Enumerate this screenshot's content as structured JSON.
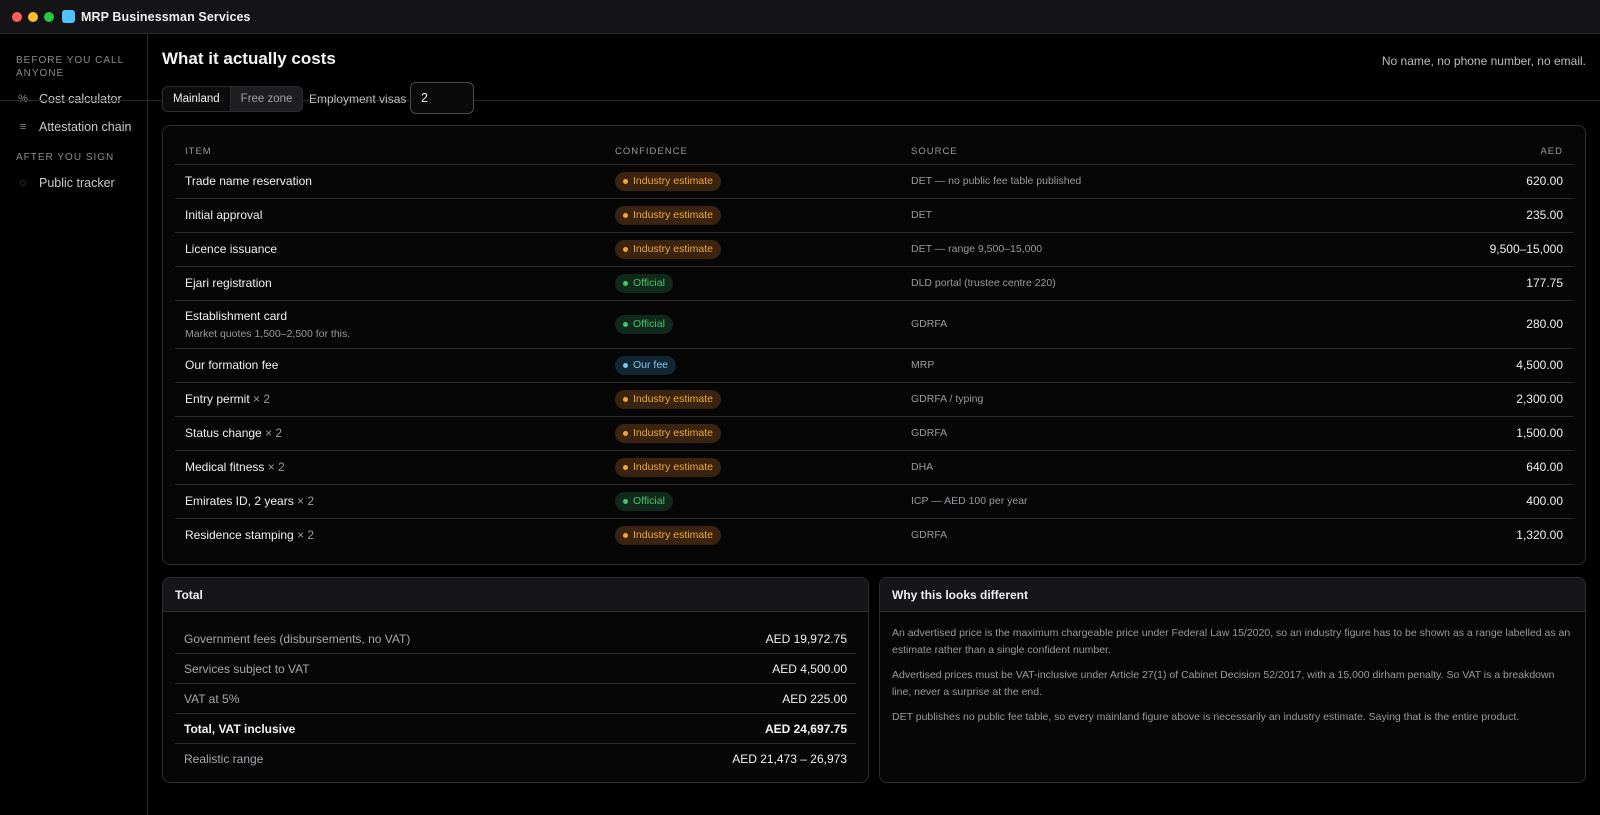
{
  "window": {
    "title": "MRP Businessman Services"
  },
  "sidebar": {
    "sections": [
      {
        "label": "BEFORE YOU CALL ANYONE"
      },
      {
        "label": "AFTER YOU SIGN"
      }
    ],
    "items": [
      {
        "icon": "%",
        "label": "Cost calculator"
      },
      {
        "icon": "≡",
        "label": "Attestation chain"
      },
      {
        "icon": "◌",
        "label": "Public tracker"
      }
    ]
  },
  "header": {
    "title": "What it actually costs",
    "privacy_note": "No name, no phone number, no email."
  },
  "controls": {
    "zones": [
      "Mainland",
      "Free zone"
    ],
    "selected_zone": "Mainland",
    "visas_label": "Employment visas",
    "visas_value": "2"
  },
  "table": {
    "headers": {
      "item": "ITEM",
      "confidence": "CONFIDENCE",
      "source": "SOURCE",
      "amount": "AED"
    },
    "rows": [
      {
        "item": "Trade name reservation",
        "mult": "",
        "note": "",
        "confidence": "Industry estimate",
        "kind": "est",
        "source": "DET — no public fee table published",
        "amount": "620.00"
      },
      {
        "item": "Initial approval",
        "mult": "",
        "note": "",
        "confidence": "Industry estimate",
        "kind": "est",
        "source": "DET",
        "amount": "235.00"
      },
      {
        "item": "Licence issuance",
        "mult": "",
        "note": "",
        "confidence": "Industry estimate",
        "kind": "est",
        "source": "DET — range 9,500–15,000",
        "amount": "9,500–15,000"
      },
      {
        "item": "Ejari registration",
        "mult": "",
        "note": "",
        "confidence": "Official",
        "kind": "off",
        "source": "DLD portal (trustee centre 220)",
        "amount": "177.75"
      },
      {
        "item": "Establishment card",
        "mult": "",
        "note": "Market quotes 1,500–2,500 for this.",
        "confidence": "Official",
        "kind": "off",
        "source": "GDRFA",
        "amount": "280.00"
      },
      {
        "item": "Our formation fee",
        "mult": "",
        "note": "",
        "confidence": "Our fee",
        "kind": "fee",
        "source": "MRP",
        "amount": "4,500.00"
      },
      {
        "item": "Entry permit",
        "mult": "× 2",
        "note": "",
        "confidence": "Industry estimate",
        "kind": "est",
        "source": "GDRFA / typing",
        "amount": "2,300.00"
      },
      {
        "item": "Status change",
        "mult": "× 2",
        "note": "",
        "confidence": "Industry estimate",
        "kind": "est",
        "source": "GDRFA",
        "amount": "1,500.00"
      },
      {
        "item": "Medical fitness",
        "mult": "× 2",
        "note": "",
        "confidence": "Industry estimate",
        "kind": "est",
        "source": "DHA",
        "amount": "640.00"
      },
      {
        "item": "Emirates ID, 2 years",
        "mult": "× 2",
        "note": "",
        "confidence": "Official",
        "kind": "off",
        "source": "ICP — AED 100 per year",
        "amount": "400.00"
      },
      {
        "item": "Residence stamping",
        "mult": "× 2",
        "note": "",
        "confidence": "Industry estimate",
        "kind": "est",
        "source": "GDRFA",
        "amount": "1,320.00"
      }
    ]
  },
  "total": {
    "title": "Total",
    "rows": [
      {
        "label": "Government fees (disbursements, no VAT)",
        "value": "AED 19,972.75",
        "bold": false
      },
      {
        "label": "Services subject to VAT",
        "value": "AED 4,500.00",
        "bold": false
      },
      {
        "label": "VAT at 5%",
        "value": "AED 225.00",
        "bold": false
      },
      {
        "label": "Total, VAT inclusive",
        "value": "AED 24,697.75",
        "bold": true
      },
      {
        "label": "Realistic range",
        "value": "AED 21,473 – 26,973",
        "bold": false
      }
    ]
  },
  "why": {
    "title": "Why this looks different",
    "paragraphs": [
      "An advertised price is the maximum chargeable price under Federal Law 15/2020, so an industry figure has to be shown as a range labelled as an estimate rather than a single confident number.",
      "Advertised prices must be VAT-inclusive under Article 27(1) of Cabinet Decision 52/2017, with a 15,000 dirham penalty. So VAT is a breakdown line, never a surprise at the end.",
      "DET publishes no public fee table, so every mainland figure above is necessarily an industry estimate. Saying that is the entire product."
    ]
  }
}
